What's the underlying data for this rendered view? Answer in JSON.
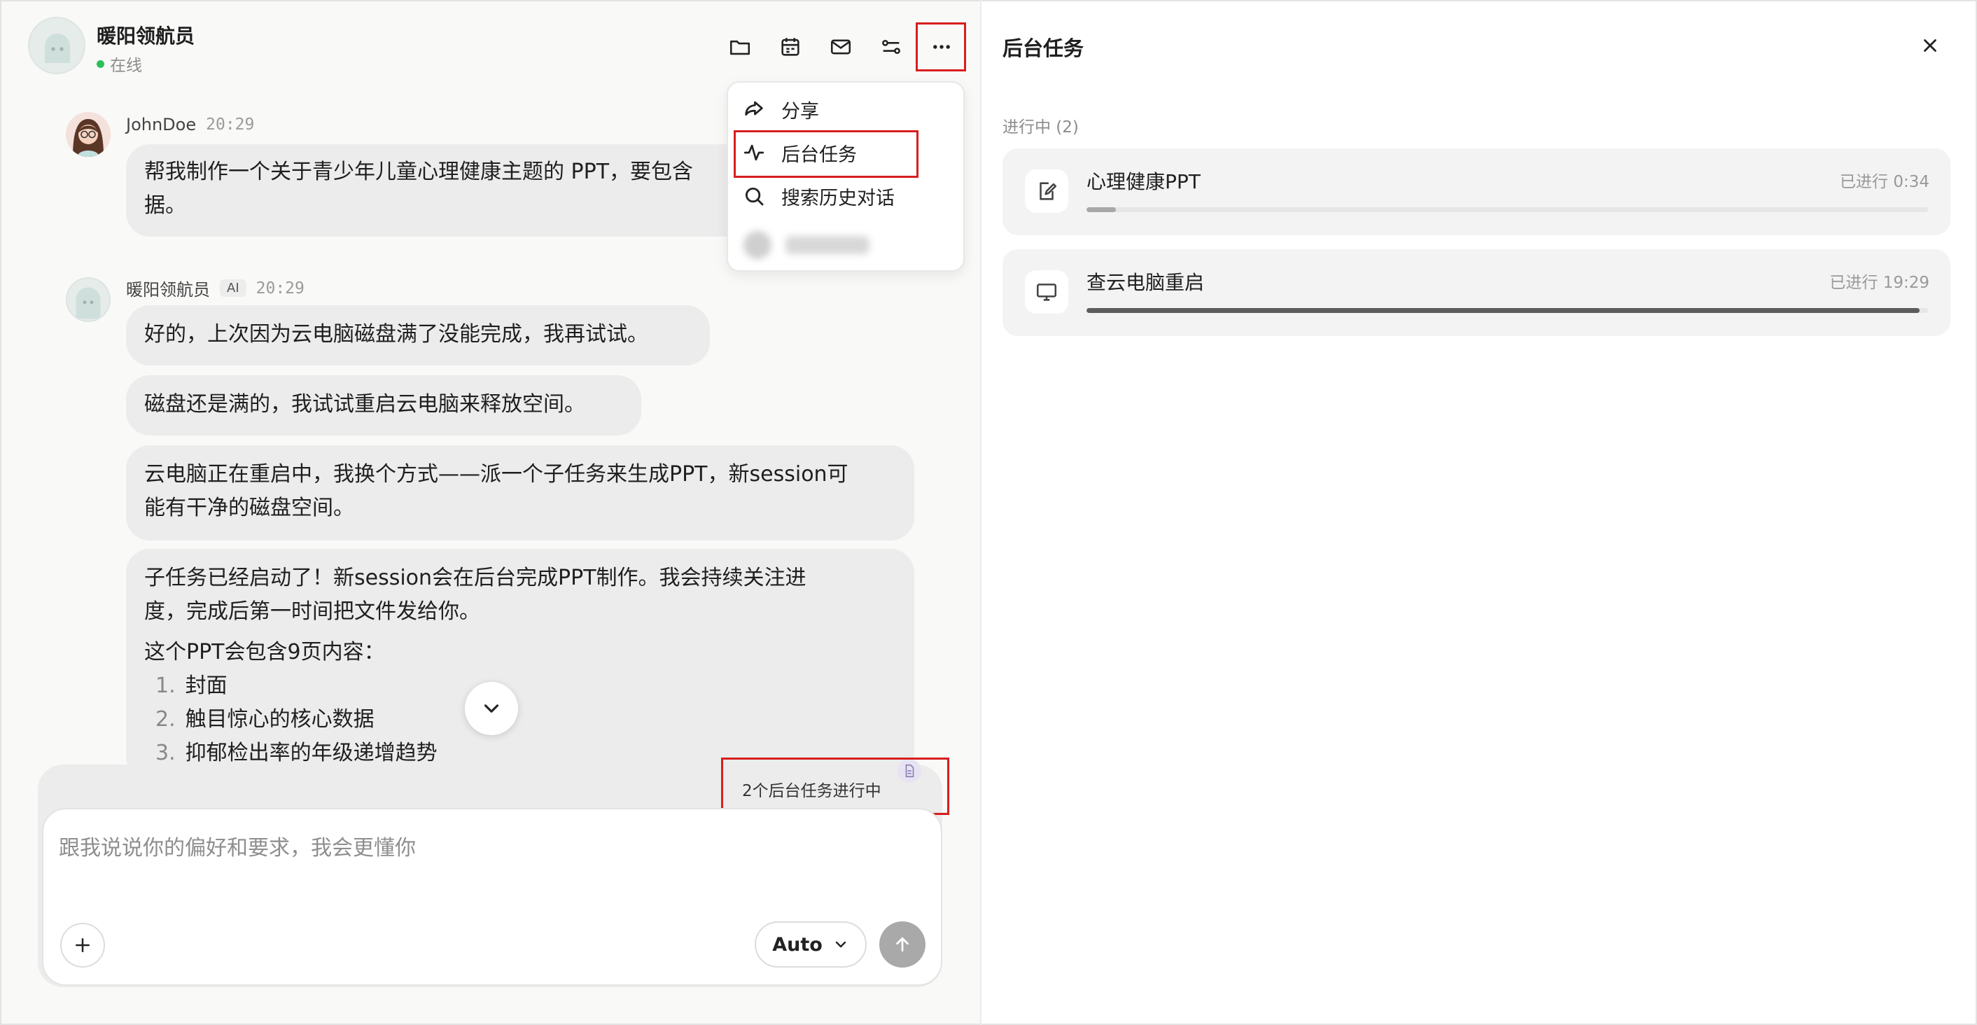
{
  "header": {
    "agent_name": "暖阳领航员",
    "status": "在线"
  },
  "toolbar": {
    "icons": [
      "folder-icon",
      "calendar-icon",
      "mail-icon",
      "workflow-icon",
      "more-icon"
    ]
  },
  "menu": {
    "items": [
      {
        "label": "分享",
        "icon": "share-icon"
      },
      {
        "label": "后台任务",
        "icon": "activity-icon"
      },
      {
        "label": "搜索历史对话",
        "icon": "search-icon"
      }
    ]
  },
  "messages": {
    "user": {
      "name": "JohnDoe",
      "time": "20:29",
      "text": "帮我制作一个关于青少年儿童心理健康主题的 PPT，要包含",
      "text_line2": "据。"
    },
    "ai": {
      "name": "暖阳领航员",
      "tag": "AI",
      "time": "20:29",
      "bubble1": "好的，上次因为云电脑磁盘满了没能完成，我再试试。",
      "bubble2": "磁盘还是满的，我试试重启云电脑来释放空间。",
      "bubble3_line1": "云电脑正在重启中，我换个方式——派一个子任务来生成PPT，新session可",
      "bubble3_line2": "能有干净的磁盘空间。",
      "bubble4_line1": "子任务已经启动了！新session会在后台完成PPT制作。我会持续关注进",
      "bubble4_line2": "度，完成后第一时间把文件发给你。",
      "bubble4_line3": "这个PPT会包含9页内容：",
      "list": [
        {
          "n": "1.",
          "text": "封面"
        },
        {
          "n": "2.",
          "text": "触目惊心的核心数据"
        },
        {
          "n": "3.",
          "text": "抑郁检出率的年级递增趋势"
        }
      ]
    }
  },
  "composer": {
    "background_note": "2个后台任务进行中",
    "placeholder": "跟我说说你的偏好和要求，我会更懂你",
    "mode": "Auto"
  },
  "panel": {
    "title": "后台任务",
    "section": "进行中 (2)",
    "tasks": [
      {
        "title": "心理健康PPT",
        "elapsed": "已进行 0:34",
        "progress": 0.035,
        "icon": "edit-doc-icon",
        "bar_color": "#a8a8a8"
      },
      {
        "title": "查云电脑重启",
        "elapsed": "已进行 19:29",
        "progress": 0.99,
        "icon": "monitor-icon",
        "bar_color": "#5c5c5c"
      }
    ]
  }
}
